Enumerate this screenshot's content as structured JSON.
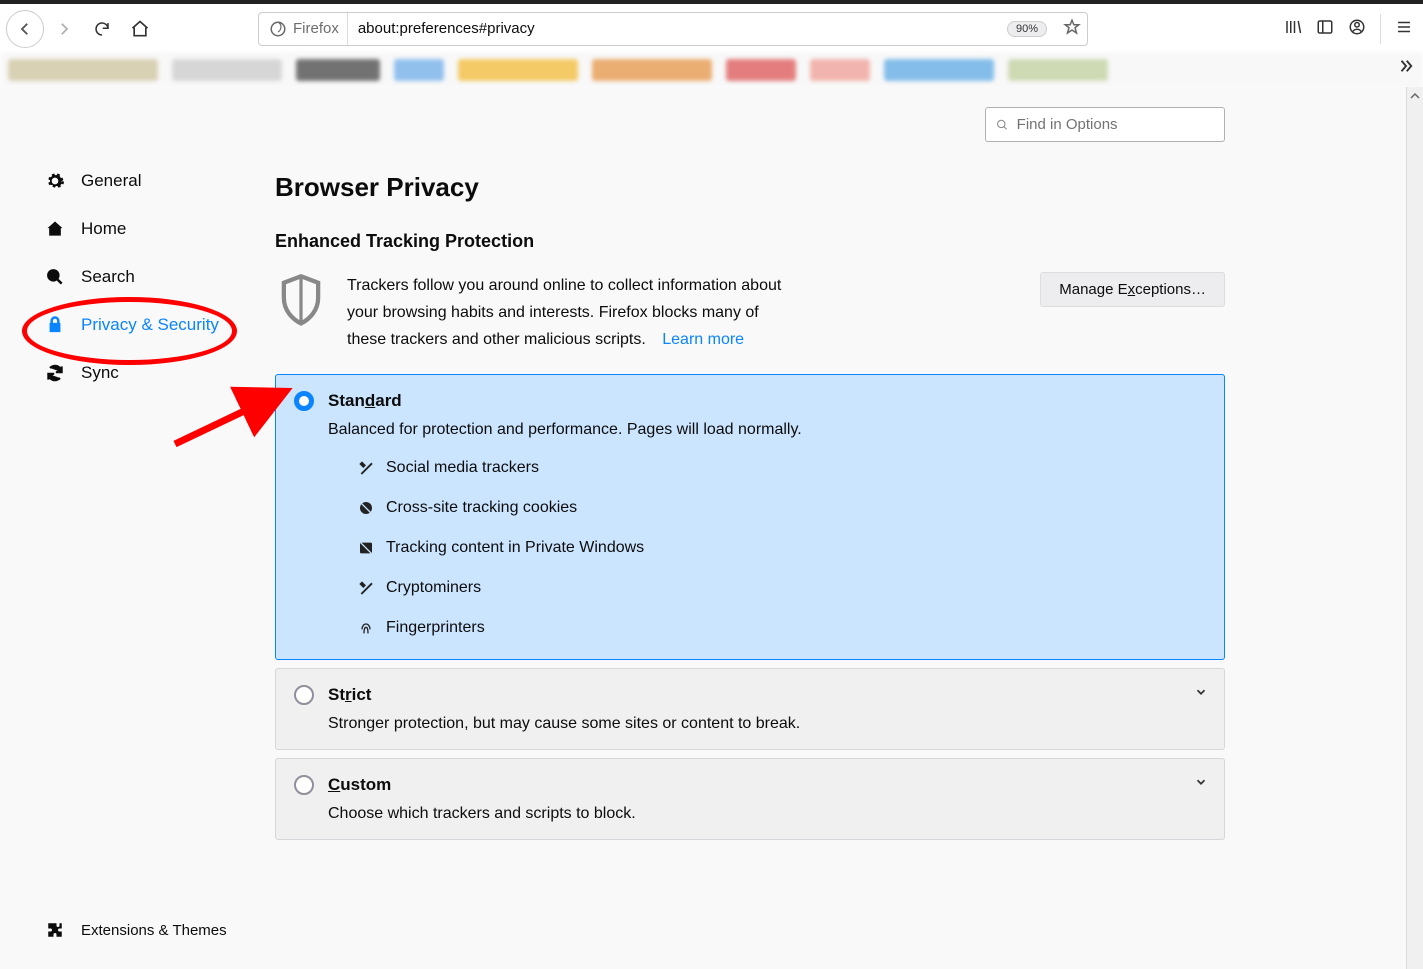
{
  "chrome": {
    "identity_label": "Firefox",
    "url": "about:preferences#privacy",
    "zoom": "90%"
  },
  "search": {
    "placeholder": "Find in Options"
  },
  "sidebar": {
    "items": [
      {
        "label": "General"
      },
      {
        "label": "Home"
      },
      {
        "label": "Search"
      },
      {
        "label": "Privacy & Security"
      },
      {
        "label": "Sync"
      }
    ],
    "bottom": [
      {
        "label": "Extensions & Themes"
      }
    ]
  },
  "page": {
    "title": "Browser Privacy",
    "section_heading": "Enhanced Tracking Protection",
    "etp_desc": "Trackers follow you around online to collect information about your browsing habits and interests. Firefox blocks many of these trackers and other malicious scripts.",
    "learn_more": "Learn more",
    "manage_exceptions_pre": "Manage E",
    "manage_exceptions_u": "x",
    "manage_exceptions_post": "ceptions…"
  },
  "options": {
    "standard": {
      "title_pre": "Stan",
      "title_u": "d",
      "title_post": "ard",
      "sub": "Balanced for protection and performance. Pages will load normally.",
      "features": [
        "Social media trackers",
        "Cross-site tracking cookies",
        "Tracking content in Private Windows",
        "Cryptominers",
        "Fingerprinters"
      ]
    },
    "strict": {
      "title_pre": "St",
      "title_u": "r",
      "title_post": "ict",
      "sub": "Stronger protection, but may cause some sites or content to break."
    },
    "custom": {
      "title_u": "C",
      "title_post": "ustom",
      "sub": "Choose which trackers and scripts to block."
    }
  }
}
